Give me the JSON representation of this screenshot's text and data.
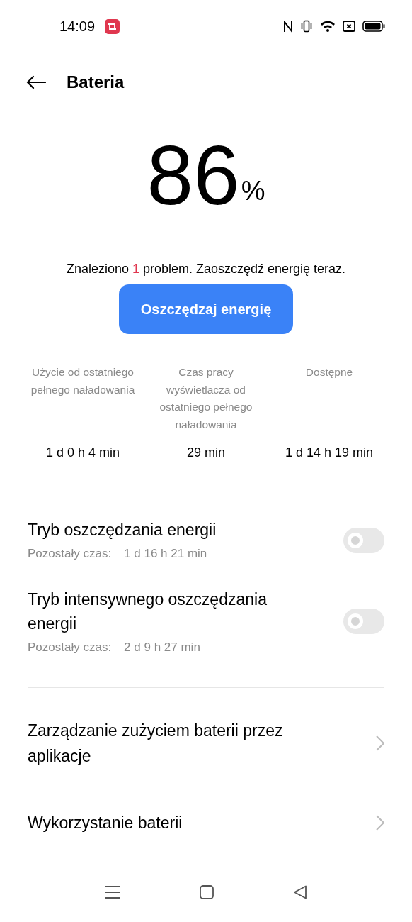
{
  "status_bar": {
    "time": "14:09"
  },
  "header": {
    "title": "Bateria"
  },
  "battery": {
    "percent": "86",
    "unit": "%"
  },
  "message": [
    {
      "text": "Znaleziono ",
      "highlight": false
    },
    {
      "text": "1",
      "highlight": true
    },
    {
      "text": " problem. Zaoszczędź energię teraz.",
      "highlight": false
    }
  ],
  "action_button": "Oszczędzaj energię",
  "stats": [
    {
      "label": "Użycie od ostatniego pełnego naładowania",
      "value": "1 d 0 h 4 min"
    },
    {
      "label": "Czas pracy wyświetlacza od ostatniego pełnego naładowania",
      "value": "29 min"
    },
    {
      "label": "Dostępne",
      "value": "1 d 14 h 19 min"
    }
  ],
  "modes": [
    {
      "title": "Tryb oszczędzania energii",
      "remaining_label": "Pozostały czas:",
      "remaining": "1 d 16 h 21 min",
      "on": false,
      "separator": true
    },
    {
      "title": "Tryb intensywnego oszczędzania energii",
      "remaining_label": "Pozostały czas:",
      "remaining": "2 d 9 h 27 min",
      "on": false,
      "separator": false
    }
  ],
  "links": [
    "Zarządzanie zużyciem baterii przez aplikacje",
    "Wykorzystanie baterii"
  ]
}
